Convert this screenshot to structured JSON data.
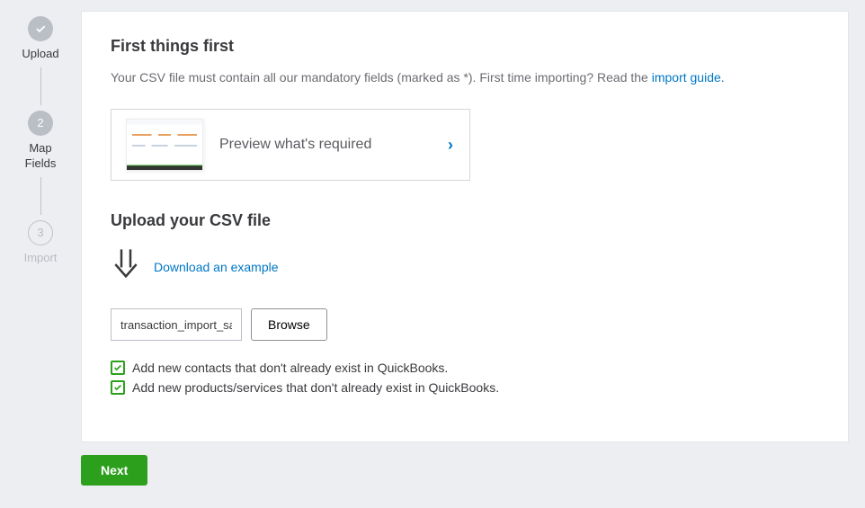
{
  "steps": {
    "s1": {
      "label": "Upload"
    },
    "s2": {
      "num": "2",
      "labelA": "Map",
      "labelB": "Fields"
    },
    "s3": {
      "num": "3",
      "label": "Import"
    }
  },
  "section1": {
    "title": "First things first",
    "intro_prefix": "Your CSV file must contain all our mandatory fields (marked as *). First time importing? Read the ",
    "link": "import guide"
  },
  "preview": {
    "label": "Preview what's required"
  },
  "section2": {
    "title": "Upload your CSV file",
    "download_link": "Download an example",
    "file_value": "transaction_import_sa",
    "browse": "Browse",
    "check_contacts": "Add new contacts that don't already exist in QuickBooks.",
    "check_products": "Add new products/services that don't already exist in QuickBooks."
  },
  "footer": {
    "next": "Next"
  }
}
